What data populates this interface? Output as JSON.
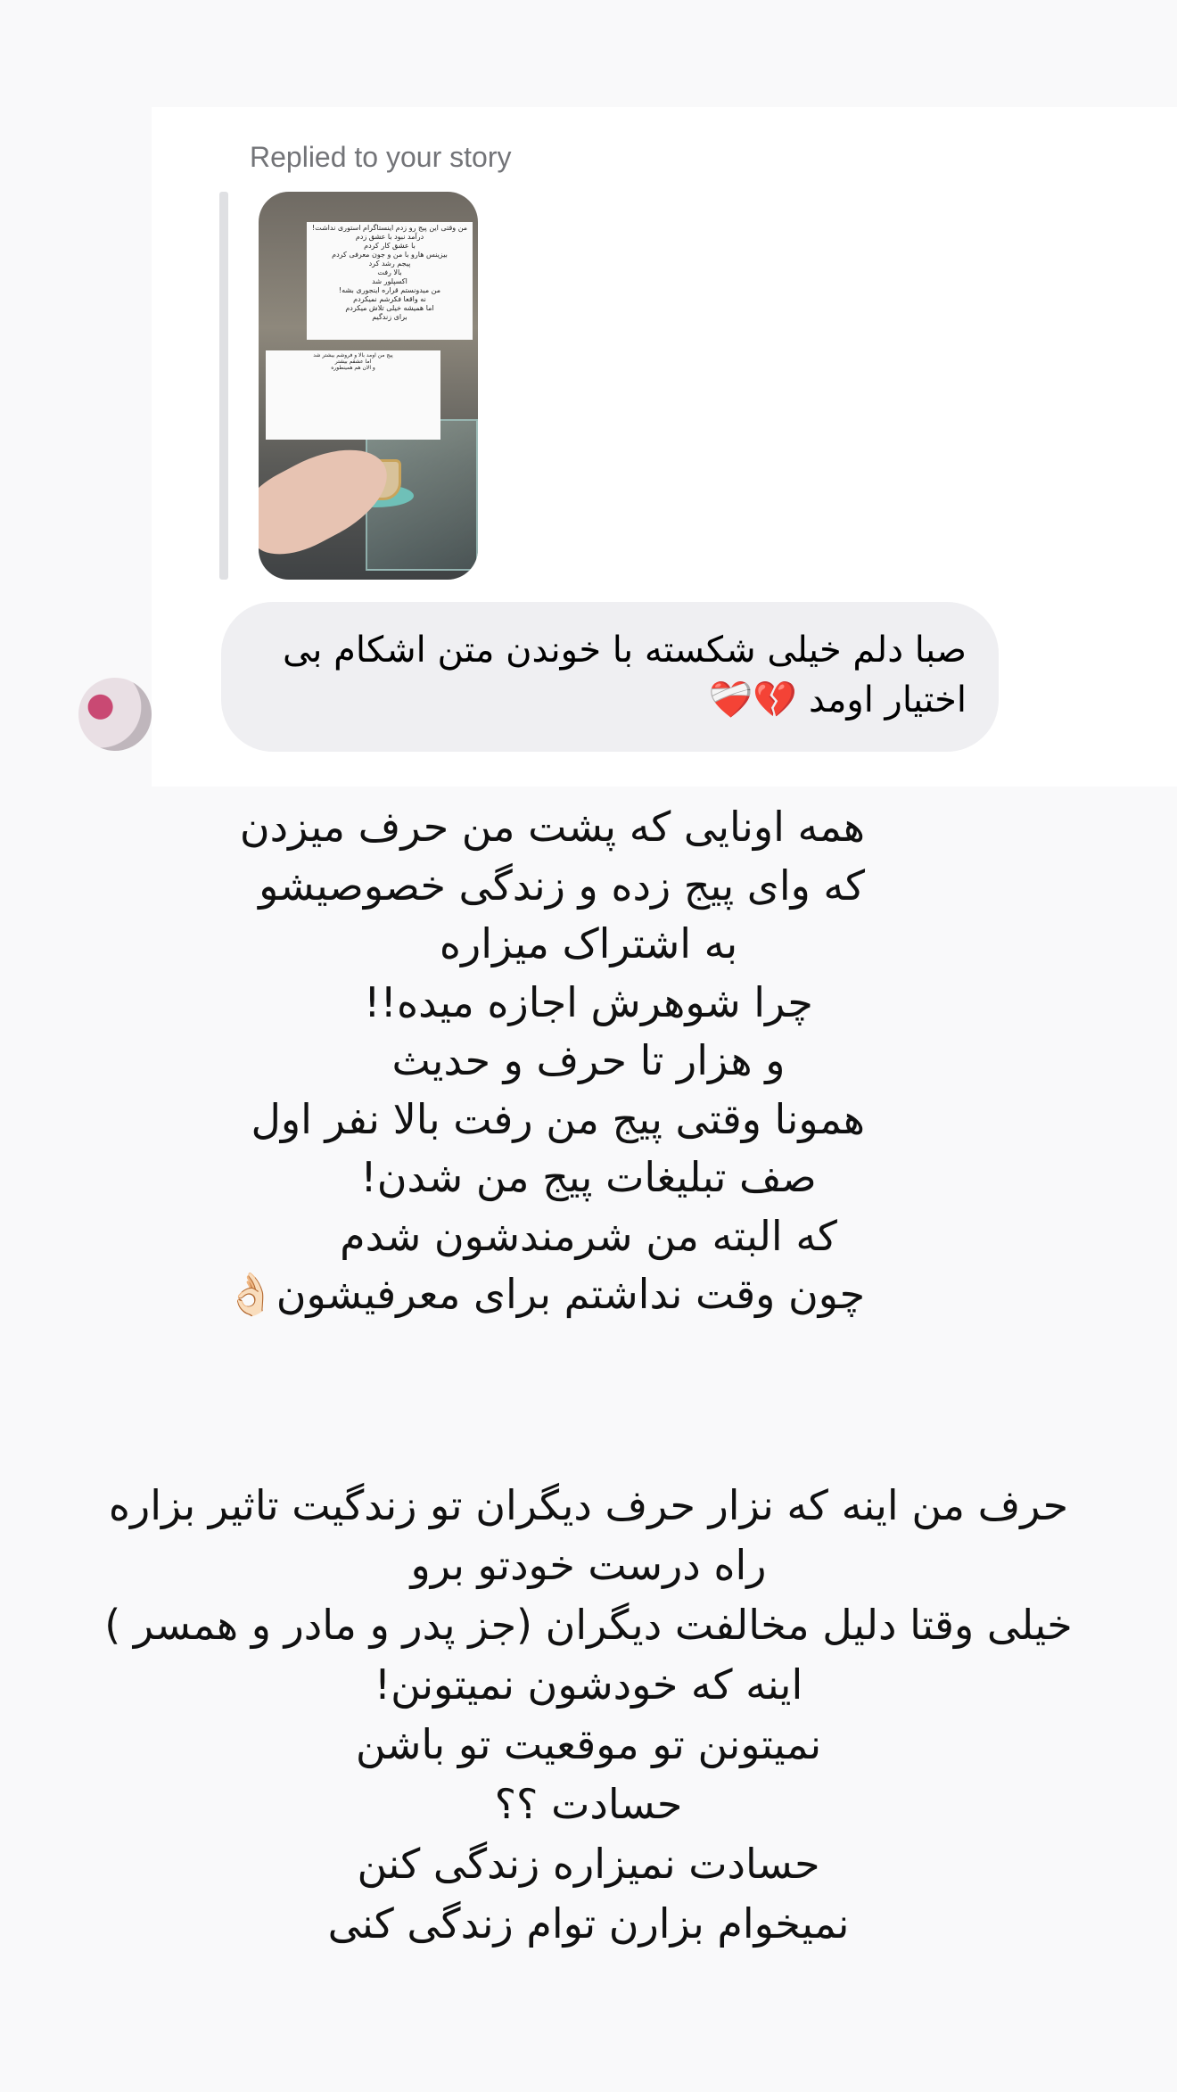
{
  "dm": {
    "replied_label": "Replied to your story",
    "story_preview": {
      "note_text_primary": "من وقتی این پیج رو زدم اینستاگرام استوری نداشت!\nدرآمد نبود با عشق زدم\nبا عشق کار کردم\nبیزینس هارو با من و جون معرفی کردم\nپیجم رشد کرد\nبالا رفت\nاکسپلور شد\nمن میدونستم قراره اینجوری بشه!\nنه واقعا فکرشم نمیکردم\nاما همیشه خیلی تلاش میکردم\nبرای زندگیم",
      "note_text_secondary": "پیج من اومد بالا و فروشم بیشتر شد\nاما عشقم بیشتر\nو الان هم همینطوره"
    },
    "reply_message": "صبا دلم خیلی شکسته با خوندن متن اشکام بی اختیار اومد 💔❤️‍🩹"
  },
  "story_text_block_one": [
    "همه اونایی که پشت من حرف میزدن",
    "که وای پیج زده و زندگی خصوصیشو",
    "به اشتراک میزاره",
    "چرا شوهرش اجازه میده!!",
    "و هزار تا حرف و حدیث",
    "همونا وقتی پیج من رفت بالا نفر اول",
    "صف تبلیغات پیج من شدن!",
    "که البته من شرمندشون شدم",
    "چون وقت نداشتم برای معرفیشون👌🏻"
  ],
  "story_text_block_two": [
    "حرف من اینه که نزار حرف دیگران تو زندگیت تاثیر بزاره",
    "راه درست خودتو برو",
    "خیلی وقتا دلیل مخالفت دیگران (جز پدر و مادر و همسر )",
    "اینه که خودشون نمیتونن!",
    "نمیتونن تو موقعیت تو باشن",
    "حسادت ؟؟",
    "حسادت نمیزاره زندگی کنن",
    "نمیخوام بزارن توام زندگی کنی"
  ]
}
